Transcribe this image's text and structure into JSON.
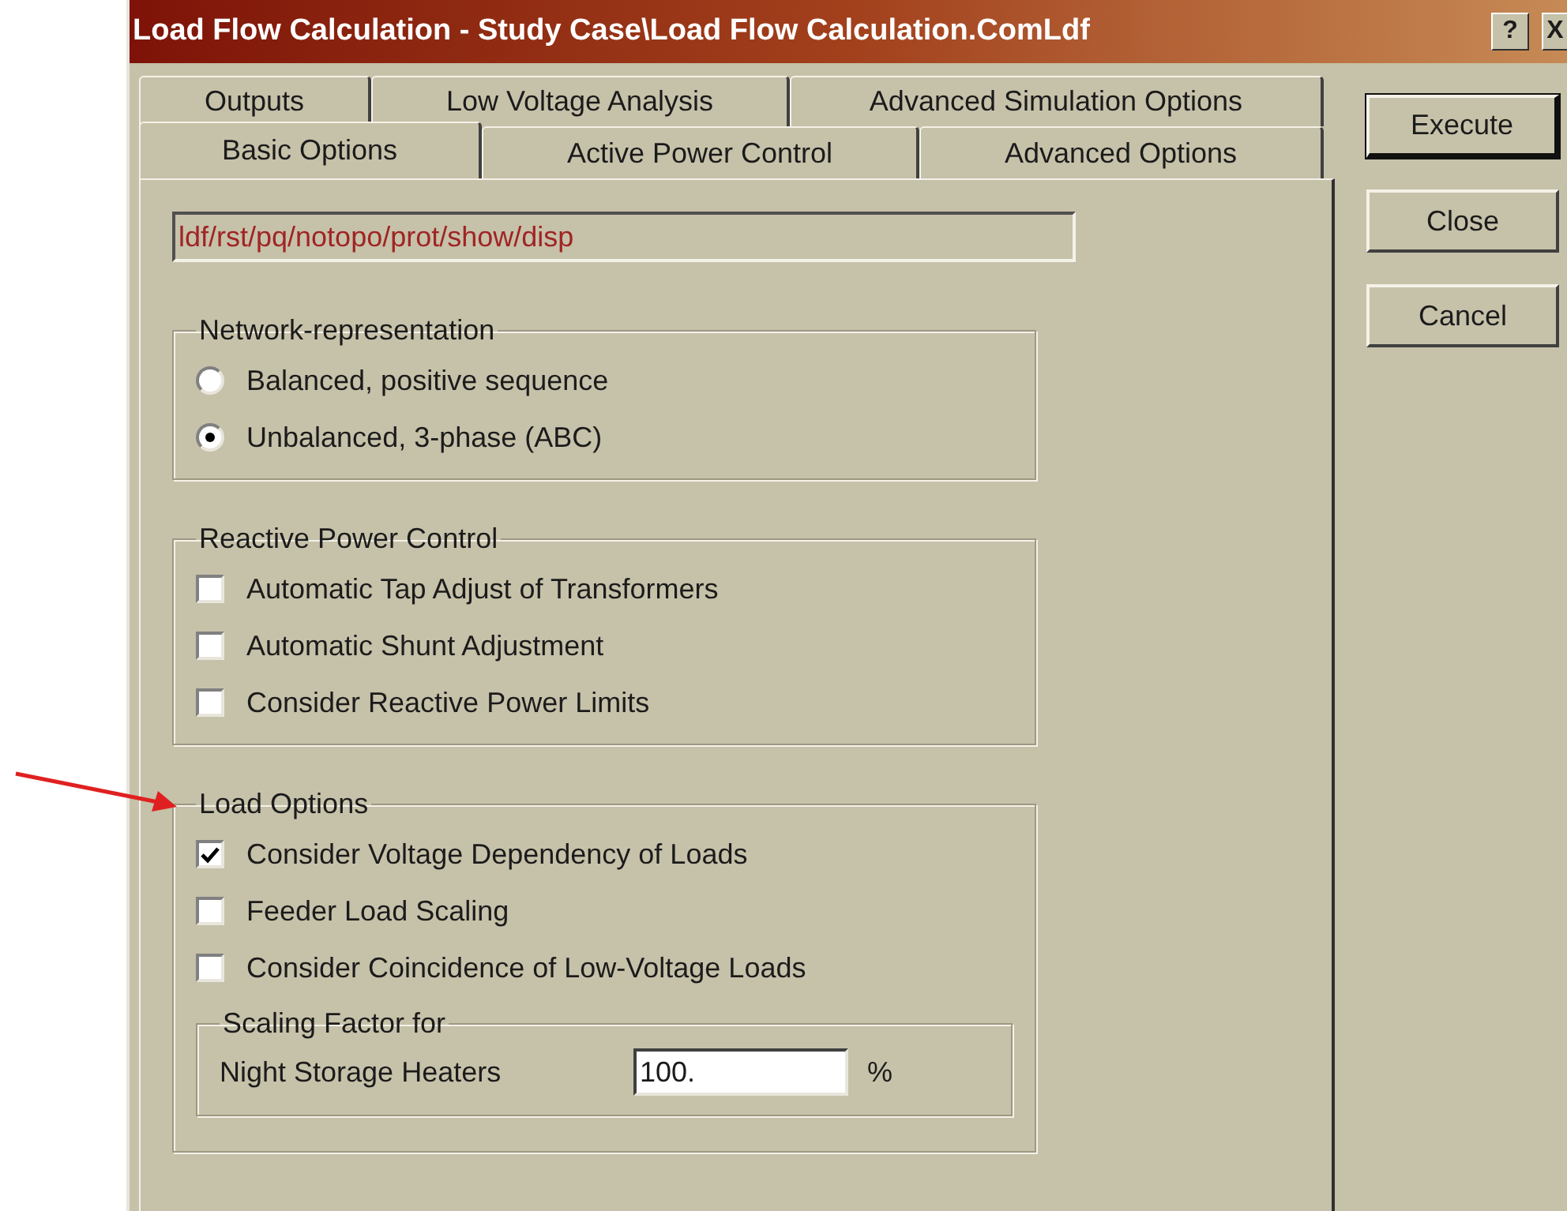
{
  "window": {
    "title": "Load Flow Calculation - Study Case\\Load Flow Calculation.ComLdf",
    "help_button": "?",
    "close_button": "X"
  },
  "tab_rows": [
    [
      {
        "label": "Outputs",
        "selected": false
      },
      {
        "label": "Low Voltage Analysis",
        "selected": false
      },
      {
        "label": "Advanced Simulation Options",
        "selected": false
      }
    ],
    [
      {
        "label": "Basic Options",
        "selected": true
      },
      {
        "label": "Active Power Control",
        "selected": false
      },
      {
        "label": "Advanced Options",
        "selected": false
      }
    ]
  ],
  "command_field": {
    "value": "ldf/rst/pq/notopo/prot/show/disp"
  },
  "groups": [
    {
      "title": "Network-representation",
      "items": [
        {
          "kind": "radio",
          "label": "Balanced, positive sequence",
          "selected": false
        },
        {
          "kind": "radio",
          "label": "Unbalanced, 3-phase (ABC)",
          "selected": true
        }
      ]
    },
    {
      "title": "Reactive Power Control",
      "items": [
        {
          "kind": "checkbox",
          "label": "Automatic Tap Adjust of Transformers",
          "checked": false
        },
        {
          "kind": "checkbox",
          "label": "Automatic Shunt Adjustment",
          "checked": false
        },
        {
          "kind": "checkbox",
          "label": "Consider Reactive Power Limits",
          "checked": false
        }
      ]
    },
    {
      "title": "Load Options",
      "items": [
        {
          "kind": "checkbox",
          "label": "Consider Voltage Dependency of Loads",
          "checked": true
        },
        {
          "kind": "checkbox",
          "label": "Feeder Load Scaling",
          "checked": false
        },
        {
          "kind": "checkbox",
          "label": "Consider Coincidence of Low-Voltage Loads",
          "checked": false
        }
      ],
      "subgroup": {
        "title": "Scaling Factor for",
        "fields": [
          {
            "label": "Night Storage Heaters",
            "value": "100.",
            "unit": "%"
          }
        ]
      }
    }
  ],
  "buttons": [
    {
      "label": "Execute",
      "default": true
    },
    {
      "label": "Close",
      "default": false
    },
    {
      "label": "Cancel",
      "default": false
    }
  ]
}
